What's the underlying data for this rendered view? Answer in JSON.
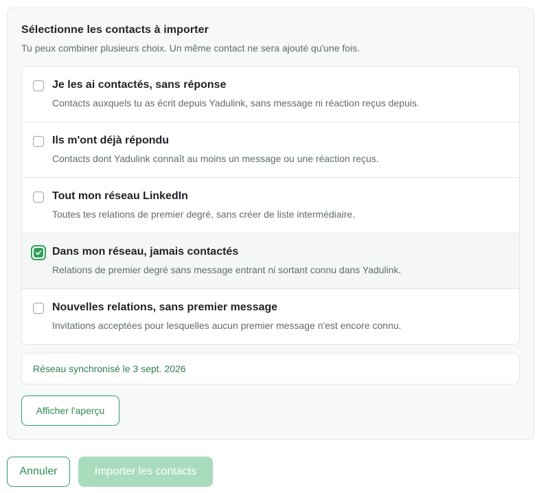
{
  "header": {
    "title": "Sélectionne les contacts à importer",
    "subtitle": "Tu peux combiner plusieurs choix. Un même contact ne sera ajouté qu'une fois."
  },
  "options": [
    {
      "title": "Je les ai contactés, sans réponse",
      "description": "Contacts auxquels tu as écrit depuis Yadulink, sans message ni réaction reçus depuis.",
      "checked": false
    },
    {
      "title": "Ils m'ont déjà répondu",
      "description": "Contacts dont Yadulink connaît au moins un message ou une réaction reçus.",
      "checked": false
    },
    {
      "title": "Tout mon réseau LinkedIn",
      "description": "Toutes tes relations de premier degré, sans créer de liste intermédiaire.",
      "checked": false
    },
    {
      "title": "Dans mon réseau, jamais contactés",
      "description": "Relations de premier degré sans message entrant ni sortant connu dans Yadulink.",
      "checked": true
    },
    {
      "title": "Nouvelles relations, sans premier message",
      "description": "Invitations acceptées pour lesquelles aucun premier message n'est encore connu.",
      "checked": false
    }
  ],
  "sync_status": "Réseau synchronisé le 3 sept. 2026",
  "buttons": {
    "preview": "Afficher l'aperçu",
    "cancel": "Annuler",
    "import": "Importer les contacts"
  },
  "colors": {
    "accent": "#2f9e5b",
    "accent_disabled": "#a9dcbc",
    "sync_text": "#2e7d4f"
  }
}
